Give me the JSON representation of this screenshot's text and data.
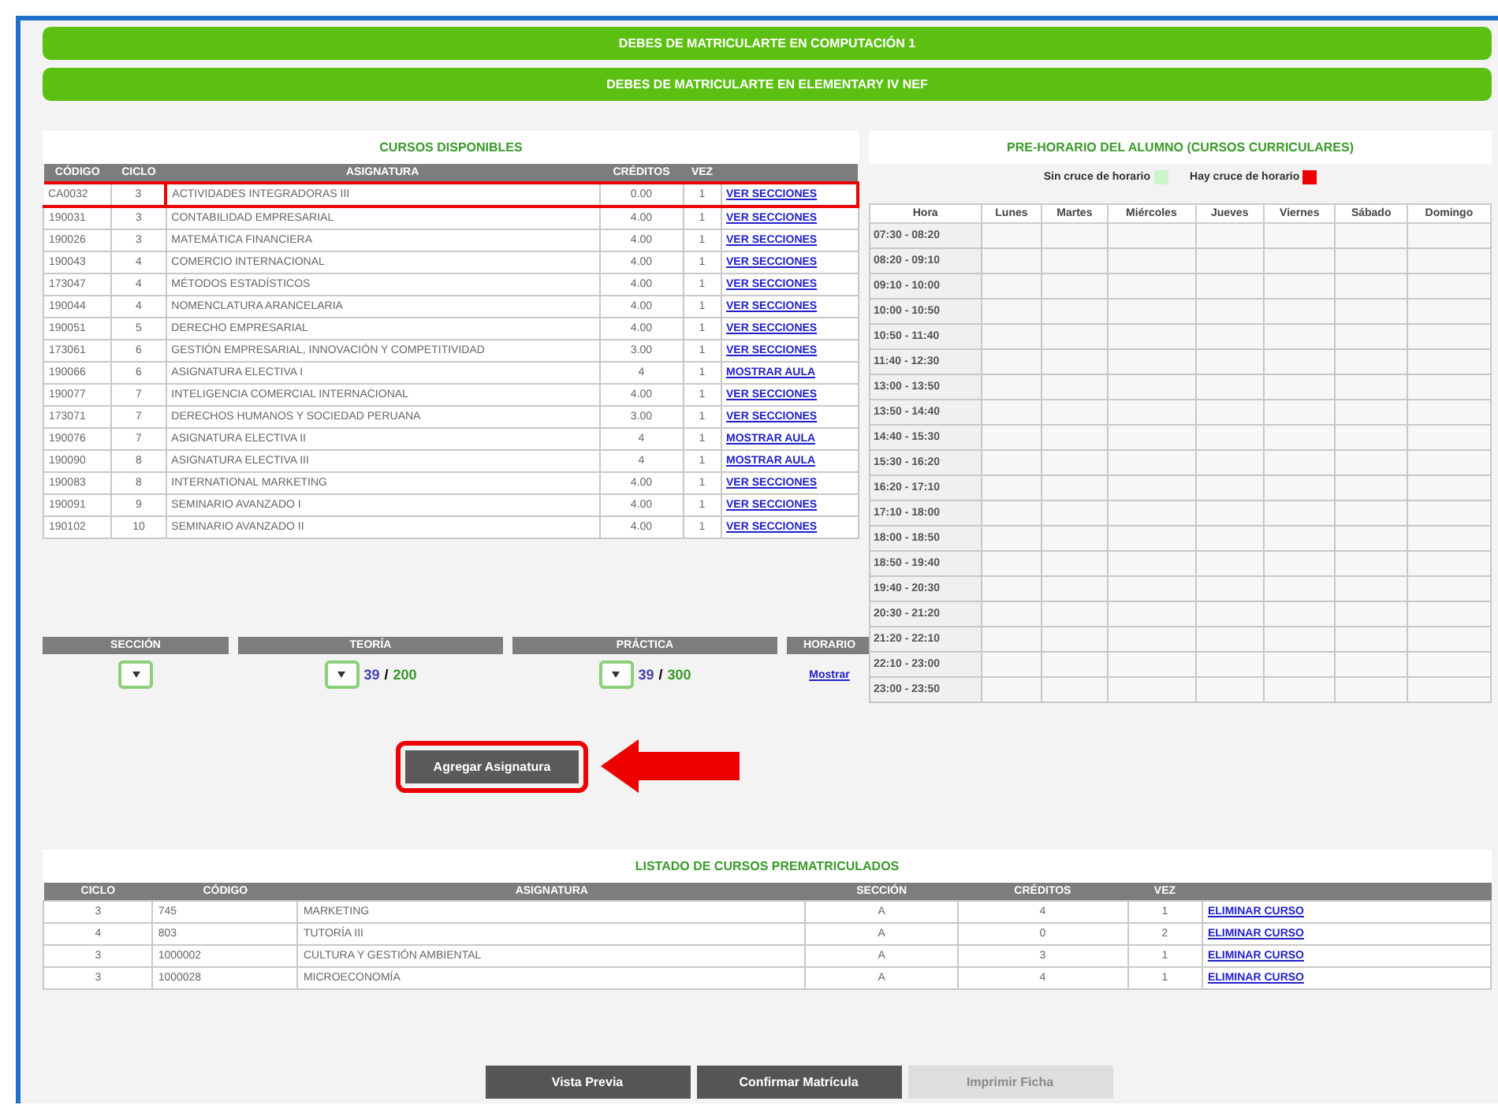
{
  "alerts": [
    "DEBES DE MATRICULARTE EN COMPUTACIÓN 1",
    "DEBES DE MATRICULARTE EN ELEMENTARY IV NEF"
  ],
  "courses": {
    "title": "CURSOS DISPONIBLES",
    "columns": [
      "CÓDIGO",
      "CICLO",
      "ASIGNATURA",
      "CRÉDITOS",
      "VEZ"
    ],
    "rows": [
      {
        "code": "CA0032",
        "cycle": "3",
        "subject": "ACTIVIDADES INTEGRADORAS III",
        "credits": "0.00",
        "times": "1",
        "action": "VER SECCIONES",
        "highlighted": true
      },
      {
        "code": "190031",
        "cycle": "3",
        "subject": "CONTABILIDAD EMPRESARIAL",
        "credits": "4.00",
        "times": "1",
        "action": "VER SECCIONES",
        "highlighted": false
      },
      {
        "code": "190026",
        "cycle": "3",
        "subject": "MATEMÁTICA FINANCIERA",
        "credits": "4.00",
        "times": "1",
        "action": "VER SECCIONES",
        "highlighted": false
      },
      {
        "code": "190043",
        "cycle": "4",
        "subject": "COMERCIO INTERNACIONAL",
        "credits": "4.00",
        "times": "1",
        "action": "VER SECCIONES",
        "highlighted": false
      },
      {
        "code": "173047",
        "cycle": "4",
        "subject": "MÉTODOS ESTADÍSTICOS",
        "credits": "4.00",
        "times": "1",
        "action": "VER SECCIONES",
        "highlighted": false
      },
      {
        "code": "190044",
        "cycle": "4",
        "subject": "NOMENCLATURA ARANCELARIA",
        "credits": "4.00",
        "times": "1",
        "action": "VER SECCIONES",
        "highlighted": false
      },
      {
        "code": "190051",
        "cycle": "5",
        "subject": "DERECHO EMPRESARIAL",
        "credits": "4.00",
        "times": "1",
        "action": "VER SECCIONES",
        "highlighted": false
      },
      {
        "code": "173061",
        "cycle": "6",
        "subject": "GESTIÓN EMPRESARIAL, INNOVACIÓN Y COMPETITIVIDAD",
        "credits": "3.00",
        "times": "1",
        "action": "VER SECCIONES",
        "highlighted": false
      },
      {
        "code": "190066",
        "cycle": "6",
        "subject": "ASIGNATURA ELECTIVA I",
        "credits": "4",
        "times": "1",
        "action": "MOSTRAR AULA",
        "highlighted": false
      },
      {
        "code": "190077",
        "cycle": "7",
        "subject": "INTELIGENCIA COMERCIAL INTERNACIONAL",
        "credits": "4.00",
        "times": "1",
        "action": "VER SECCIONES",
        "highlighted": false
      },
      {
        "code": "173071",
        "cycle": "7",
        "subject": "DERECHOS HUMANOS Y SOCIEDAD PERUANA",
        "credits": "3.00",
        "times": "1",
        "action": "VER SECCIONES",
        "highlighted": false
      },
      {
        "code": "190076",
        "cycle": "7",
        "subject": "ASIGNATURA ELECTIVA II",
        "credits": "4",
        "times": "1",
        "action": "MOSTRAR AULA",
        "highlighted": false
      },
      {
        "code": "190090",
        "cycle": "8",
        "subject": "ASIGNATURA ELECTIVA III",
        "credits": "4",
        "times": "1",
        "action": "MOSTRAR AULA",
        "highlighted": false
      },
      {
        "code": "190083",
        "cycle": "8",
        "subject": "INTERNATIONAL MARKETING",
        "credits": "4.00",
        "times": "1",
        "action": "VER SECCIONES",
        "highlighted": false
      },
      {
        "code": "190091",
        "cycle": "9",
        "subject": "SEMINARIO AVANZADO I",
        "credits": "4.00",
        "times": "1",
        "action": "VER SECCIONES",
        "highlighted": false
      },
      {
        "code": "190102",
        "cycle": "10",
        "subject": "SEMINARIO AVANZADO II",
        "credits": "4.00",
        "times": "1",
        "action": "VER SECCIONES",
        "highlighted": false
      }
    ]
  },
  "section_form": {
    "columns": [
      "SECCIÓN",
      "TEORÍA",
      "PRÁCTICA",
      "HORARIO"
    ],
    "theory": {
      "used": "39",
      "separator": "/",
      "capacity": "200"
    },
    "practice": {
      "used": "39",
      "separator": "/",
      "capacity": "300"
    },
    "schedule_link": "Mostrar",
    "add_button": {
      "label": "Agregar Asignatura",
      "highlighted": true
    }
  },
  "schedule": {
    "title": "PRE-HORARIO DEL ALUMNO (CURSOS CURRICULARES)",
    "legend": [
      {
        "label": "Sin cruce de horario",
        "color": "#ccf5cc"
      },
      {
        "label": "Hay cruce de horario",
        "color": "#ee0000"
      }
    ],
    "columns": [
      "Hora",
      "Lunes",
      "Martes",
      "Miércoles",
      "Jueves",
      "Viernes",
      "Sábado",
      "Domingo"
    ],
    "hours": [
      "07:30 - 08:20",
      "08:20 - 09:10",
      "09:10 - 10:00",
      "10:00 - 10:50",
      "10:50 - 11:40",
      "11:40 - 12:30",
      "13:00 - 13:50",
      "13:50 - 14:40",
      "14:40 - 15:30",
      "15:30 - 16:20",
      "16:20 - 17:10",
      "17:10 - 18:00",
      "18:00 - 18:50",
      "18:50 - 19:40",
      "19:40 - 20:30",
      "20:30 - 21:20",
      "21:20 - 22:10",
      "22:10 - 23:00",
      "23:00 - 23:50"
    ]
  },
  "enrolled": {
    "title": "LISTADO DE CURSOS PREMATRICULADOS",
    "columns": [
      "CICLO",
      "CÓDIGO",
      "ASIGNATURA",
      "SECCIÓN",
      "CRÉDITOS",
      "VEZ"
    ],
    "rows": [
      {
        "cycle": "3",
        "code": "745",
        "subject": "MARKETING",
        "section": "A",
        "credits": "4",
        "times": "1",
        "action": "ELIMINAR CURSO"
      },
      {
        "cycle": "4",
        "code": "803",
        "subject": "TUTORÍA III",
        "section": "A",
        "credits": "0",
        "times": "2",
        "action": "ELIMINAR CURSO"
      },
      {
        "cycle": "3",
        "code": "1000002",
        "subject": "CULTURA Y GESTIÓN AMBIENTAL",
        "section": "A",
        "credits": "3",
        "times": "1",
        "action": "ELIMINAR CURSO"
      },
      {
        "cycle": "3",
        "code": "1000028",
        "subject": "MICROECONOMÍA",
        "section": "A",
        "credits": "4",
        "times": "1",
        "action": "ELIMINAR CURSO"
      }
    ]
  },
  "footer_buttons": [
    {
      "label": "Vista Previa",
      "disabled": false
    },
    {
      "label": "Confirmar Matrícula",
      "disabled": false
    },
    {
      "label": "Imprimir Ficha",
      "disabled": true
    }
  ]
}
